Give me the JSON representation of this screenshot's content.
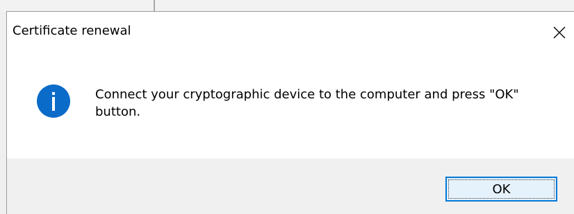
{
  "window": {
    "title": "Certificate renewal",
    "close_icon": "close-icon"
  },
  "message": {
    "icon": "info-icon",
    "text": "Connect your cryptographic device to the computer and press \"OK\" button."
  },
  "buttons": {
    "ok_label": "OK"
  },
  "colors": {
    "info_icon": "#0b6bc9",
    "button_border": "#0078d7",
    "button_fill": "#e5f1fb",
    "footer_bg": "#f0f0f0"
  }
}
